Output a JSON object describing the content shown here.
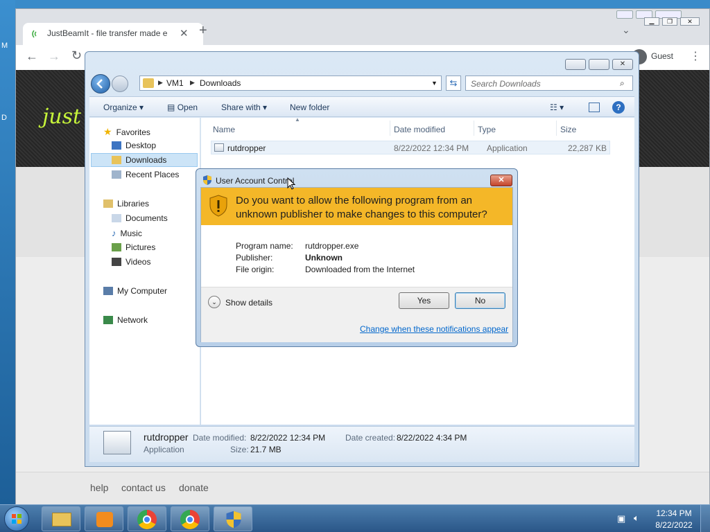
{
  "desktop": {
    "label_1": "M",
    "label_2": "D"
  },
  "chrome": {
    "tab_title": "JustBeamIt - file transfer made e",
    "profile_label": "Guest",
    "site_logo_text": "just",
    "footer_links": [
      "help",
      "contact us",
      "donate"
    ]
  },
  "explorer": {
    "breadcrumb": [
      "VM1",
      "Downloads"
    ],
    "search_placeholder": "Search Downloads",
    "toolbar": {
      "organize": "Organize",
      "open": "Open",
      "share_with": "Share with",
      "new_folder": "New folder"
    },
    "nav": {
      "favorites": "Favorites",
      "desktop": "Desktop",
      "downloads": "Downloads",
      "recent_places": "Recent Places",
      "libraries": "Libraries",
      "documents": "Documents",
      "music": "Music",
      "pictures": "Pictures",
      "videos": "Videos",
      "my_computer": "My Computer",
      "network": "Network"
    },
    "columns": {
      "name": "Name",
      "date_modified": "Date modified",
      "type": "Type",
      "size": "Size"
    },
    "files": [
      {
        "name": "rutdropper",
        "date_modified": "8/22/2022 12:34 PM",
        "type": "Application",
        "size": "22,287 KB"
      }
    ],
    "details": {
      "name": "rutdropper",
      "type": "Application",
      "date_modified_label": "Date modified:",
      "date_modified": "8/22/2022 12:34 PM",
      "date_created_label": "Date created:",
      "date_created": "8/22/2022 4:34 PM",
      "size_label": "Size:",
      "size": "21.7 MB"
    }
  },
  "uac": {
    "title": "User Account Control",
    "question": "Do you want to allow the following program from an unknown publisher to make changes to this computer?",
    "program_name_label": "Program name:",
    "program_name": "rutdropper.exe",
    "publisher_label": "Publisher:",
    "publisher": "Unknown",
    "file_origin_label": "File origin:",
    "file_origin": "Downloaded from the Internet",
    "show_details": "Show details",
    "yes": "Yes",
    "no": "No",
    "change_link": "Change when these notifications appear"
  },
  "taskbar": {
    "time": "12:34 PM",
    "date": "8/22/2022"
  },
  "colors": {
    "uac_banner": "#f4b728",
    "link": "#0066cc",
    "selection": "#cce4f7"
  }
}
